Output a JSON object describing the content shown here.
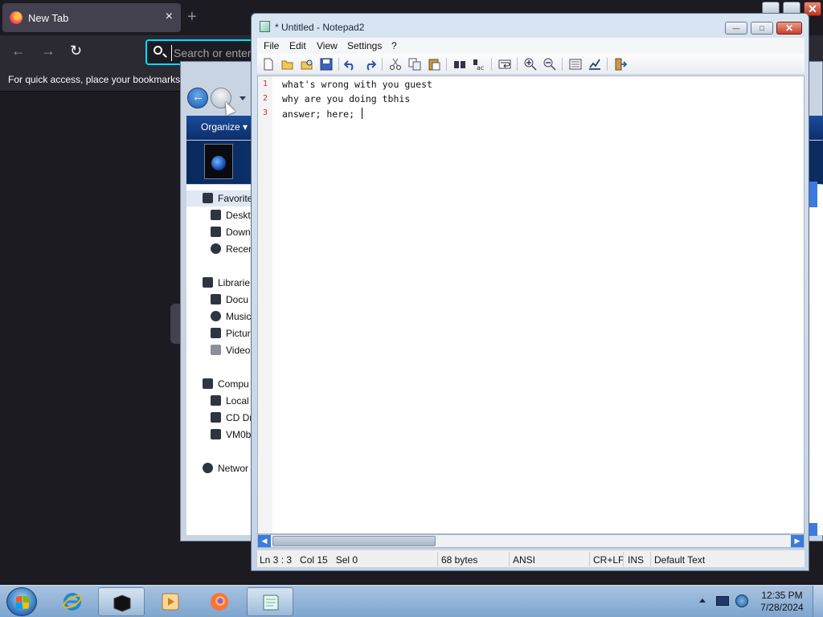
{
  "firefox": {
    "tab_title": "New Tab",
    "tab_close": "×",
    "new_tab": "+",
    "back": "←",
    "forward": "→",
    "reload": "↻",
    "url_placeholder": "Search or enter",
    "bookmarks_hint": "For quick access, place your bookmarks h"
  },
  "explorer": {
    "organize": "Organize ▾",
    "tree": [
      {
        "label": "Favorite",
        "icon": "star-icon"
      },
      {
        "label": "Deskt",
        "icon": "desktop-icon"
      },
      {
        "label": "Down",
        "icon": "downloads-icon"
      },
      {
        "label": "Recen",
        "icon": "recent-places-icon"
      },
      {
        "label": "Librarie",
        "icon": "libraries-icon"
      },
      {
        "label": "Docu",
        "icon": "documents-icon"
      },
      {
        "label": "Music",
        "icon": "music-icon"
      },
      {
        "label": "Pictur",
        "icon": "pictures-icon"
      },
      {
        "label": "Video",
        "icon": "videos-icon"
      },
      {
        "label": "Compu",
        "icon": "computer-icon"
      },
      {
        "label": "Local",
        "icon": "local-disk-icon"
      },
      {
        "label": "CD Dr",
        "icon": "cd-drive-icon"
      },
      {
        "label": "VM0b",
        "icon": "network-drive-icon"
      },
      {
        "label": "Networ",
        "icon": "network-icon"
      }
    ]
  },
  "notepad": {
    "title": "* Untitled - Notepad2",
    "menu": [
      "File",
      "Edit",
      "View",
      "Settings",
      "?"
    ],
    "toolbar_icons": [
      "new-icon",
      "open-icon",
      "browse-icon",
      "save-icon",
      "undo-icon",
      "redo-icon",
      "cut-icon",
      "copy-icon",
      "paste-icon",
      "find-icon",
      "replace-icon",
      "word-wrap-icon",
      "zoom-in-icon",
      "zoom-out-icon",
      "view-scheme-icon",
      "customize-schemes-icon",
      "exit-icon"
    ],
    "lines": [
      {
        "num": "1",
        "text": "what's wrong with you guest"
      },
      {
        "num": "2",
        "text": "why are you doing tbhis"
      },
      {
        "num": "3",
        "text": "answer; here; "
      }
    ],
    "status": {
      "position": "Ln 3 : 3   Col 15   Sel 0",
      "size": "68 bytes",
      "encoding": "ANSI",
      "eol": "CR+LF",
      "mode": "INS",
      "scheme": "Default Text"
    }
  },
  "taskbar": {
    "clock_time": "12:35 PM",
    "clock_date": "7/28/2024",
    "apps": [
      "internet-explorer-icon",
      "explorer-icon",
      "media-player-icon",
      "firefox-icon",
      "notepad2-icon"
    ]
  }
}
